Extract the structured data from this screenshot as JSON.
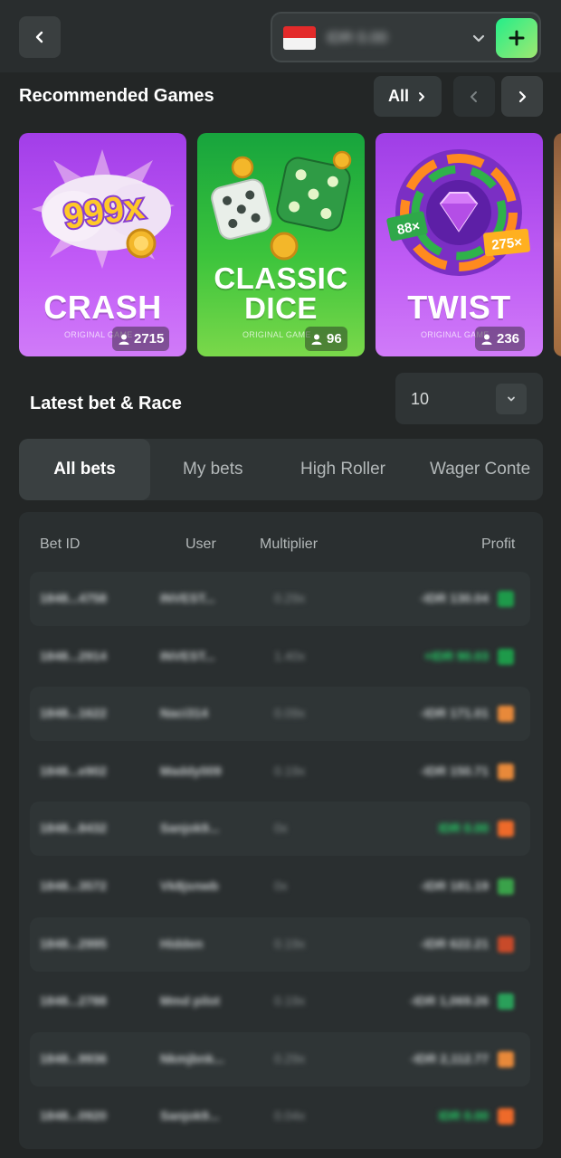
{
  "header": {
    "balance_text": "IDR 0.00",
    "colors": {
      "deposit_gradient_start": "#24ee89",
      "deposit_gradient_end": "#9fe871"
    }
  },
  "recommended": {
    "title": "Recommended Games",
    "all_label": "All",
    "games": [
      {
        "title": "CRASH",
        "subtitle": "ORIGINAL GAME",
        "players": "2715",
        "badge_text": "999x"
      },
      {
        "title_line1": "CLASSIC",
        "title_line2": "DICE",
        "subtitle": "ORIGINAL GAME",
        "players": "96"
      },
      {
        "title": "TWIST",
        "subtitle": "ORIGINAL GAME",
        "players": "236",
        "badge_left": "88×",
        "badge_right": "275×"
      }
    ]
  },
  "latest": {
    "title": "Latest bet & Race",
    "rows_value": "10",
    "tabs": [
      {
        "label": "All bets",
        "active": true
      },
      {
        "label": "My bets",
        "active": false
      },
      {
        "label": "High Roller",
        "active": false
      },
      {
        "label": "Wager Conte",
        "active": false
      }
    ],
    "columns": {
      "bet_id": "Bet ID",
      "user": "User",
      "multiplier": "Multiplier",
      "profit": "Profit"
    },
    "rows": [
      {
        "bet_id": "1848...4758",
        "user": "INVEST...",
        "multiplier": "0.29x",
        "profit": "-IDR 130.04",
        "positive": false,
        "flag": "#1e9a4a"
      },
      {
        "bet_id": "1848...2914",
        "user": "INVEST...",
        "multiplier": "1.40x",
        "profit": "+IDR 90.03",
        "positive": true,
        "flag": "#1e9a4a"
      },
      {
        "bet_id": "1848...1622",
        "user": "Naci314",
        "multiplier": "0.09x",
        "profit": "-IDR 171.01",
        "positive": false,
        "flag": "#e8893a"
      },
      {
        "bet_id": "1848...e902",
        "user": "Maddy009",
        "multiplier": "0.19x",
        "profit": "-IDR 150.71",
        "positive": false,
        "flag": "#e8893a"
      },
      {
        "bet_id": "1848...8432",
        "user": "Sanjok9...",
        "multiplier": "0x",
        "profit": "IDR 0.00",
        "positive": true,
        "flag": "#ee6a2a"
      },
      {
        "bet_id": "1848...3572",
        "user": "Vk8jsnwb",
        "multiplier": "0x",
        "profit": "-IDR 181.19",
        "positive": false,
        "flag": "#3aa24a"
      },
      {
        "bet_id": "1848...2995",
        "user": "Hidden",
        "multiplier": "0.19x",
        "profit": "-IDR 622.21",
        "positive": false,
        "flag": "#c84a2a"
      },
      {
        "bet_id": "1848...2788",
        "user": "Mmd pilot",
        "multiplier": "0.19x",
        "profit": "-IDR 1,069.26",
        "positive": false,
        "flag": "#2aa05a"
      },
      {
        "bet_id": "1848...9936",
        "user": "Nkmjbnk...",
        "multiplier": "0.29x",
        "profit": "-IDR 2,112.77",
        "positive": false,
        "flag": "#e8893a"
      },
      {
        "bet_id": "1848...0920",
        "user": "Sanjok9...",
        "multiplier": "0.04x",
        "profit": "IDR 0.00",
        "positive": true,
        "flag": "#ee6a2a"
      }
    ]
  }
}
